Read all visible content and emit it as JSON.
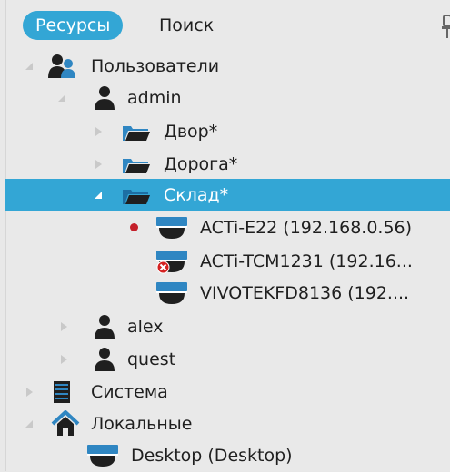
{
  "tabs": {
    "resources_label": "Ресурсы",
    "search_label": "Поиск"
  },
  "tree": {
    "users": "Пользователи",
    "admin": "admin",
    "yard": "Двор*",
    "road": "Дорога*",
    "warehouse": "Склад*",
    "cam1": "ACTi-E22 (192.168.0.56)",
    "cam2": "ACTi-TCM1231 (192.16...",
    "cam3": "VIVOTEKFD8136 (192....",
    "alex": "alex",
    "guest": "quest",
    "system": "Система",
    "local": "Локальные",
    "desktop": "Desktop (Desktop)"
  },
  "colors": {
    "accent": "#33a6d5",
    "camera_body": "#2f86c2",
    "recording_dot": "#c4202a",
    "error_badge": "#d42121"
  },
  "icons": {
    "users": "users-icon",
    "user": "user-icon",
    "folder": "folder-icon",
    "camera": "camera-icon",
    "server": "server-icon",
    "home": "home-icon",
    "pin": "pin-icon"
  }
}
